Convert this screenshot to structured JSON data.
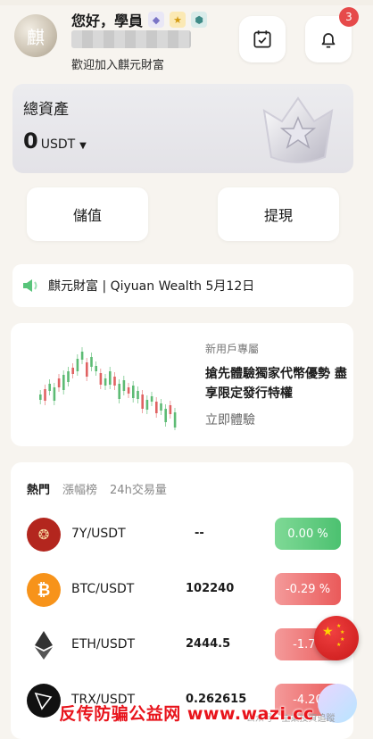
{
  "header": {
    "greeting": "您好，學員",
    "welcome": "歡迎加入麒元財富",
    "avatar_text": "麒",
    "notification_count": "3"
  },
  "assets": {
    "title": "總資產",
    "amount": "0",
    "currency": "USDT"
  },
  "actions": {
    "deposit": "儲值",
    "withdraw": "提現"
  },
  "announcement": {
    "text": "麒元財富 | Qiyuan Wealth 5月12日"
  },
  "promo": {
    "tag": "新用戶專屬",
    "headline": "搶先體驗獨家代幣優勢 盡享限定發行特權",
    "cta": "立即體驗"
  },
  "market": {
    "tabs": [
      "熱門",
      "漲幅榜",
      "24h交易量"
    ],
    "rows": [
      {
        "pair": "7Y/USDT",
        "price": "--",
        "change": "0.00 %",
        "dir": "up",
        "icon": "7y-coin-icon"
      },
      {
        "pair": "BTC/USDT",
        "price": "102240",
        "change": "-0.29 %",
        "dir": "down",
        "icon": "bitcoin-icon"
      },
      {
        "pair": "ETH/USDT",
        "price": "2444.5",
        "change": "-1.70",
        "dir": "down",
        "icon": "ethereum-icon"
      },
      {
        "pair": "TRX/USDT",
        "price": "0.262615",
        "change": "-4.20",
        "dir": "down",
        "icon": "tron-icon"
      }
    ]
  },
  "overlay": {
    "watermark": "反传防骗公益网 www.wazi.cc",
    "source": "公众号 · 主業投資追蹤"
  },
  "colors": {
    "up": "#4cc170",
    "down": "#ea5a5a",
    "badge": "#e64a4a"
  }
}
